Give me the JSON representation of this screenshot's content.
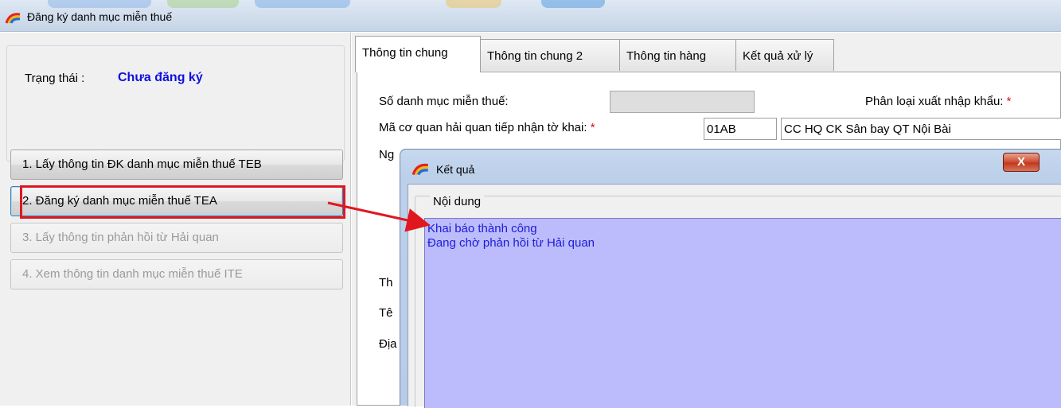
{
  "window": {
    "title": "Đăng ký danh mục miễn thuế"
  },
  "status": {
    "label": "Trạng thái :",
    "value": "Chưa đăng ký"
  },
  "actions": [
    {
      "label": "1. Lấy thông tin ĐK danh mục miễn thuế TEB",
      "state": "enabled"
    },
    {
      "label": "2. Đăng ký danh mục miễn thuế TEA",
      "state": "selected"
    },
    {
      "label": "3. Lấy thông tin phản hồi từ Hải quan",
      "state": "disabled"
    },
    {
      "label": "4. Xem thông tin danh mục miễn thuế ITE",
      "state": "disabled"
    }
  ],
  "tabs": [
    {
      "label": "Thông tin chung",
      "active": true
    },
    {
      "label": "Thông tin chung 2",
      "active": false
    },
    {
      "label": "Thông tin hàng",
      "active": false
    },
    {
      "label": "Kết quả xử lý",
      "active": false
    }
  ],
  "form": {
    "so_danh_muc_label": "Số danh mục miễn thuế:",
    "so_danh_muc_value": "",
    "phan_loai_label": "Phân loại xuất nhập khẩu:",
    "required_mark": "*",
    "ma_co_quan_label": "Mã cơ quan hải quan tiếp nhận tờ khai:",
    "ma_co_quan_code": "01AB",
    "ma_co_quan_name": "CC HQ CK Sân bay QT Nội Bài",
    "partial_label_1": "Ng",
    "partial_label_2": "Th",
    "partial_label_3": "Tê",
    "partial_label_4": "Địa"
  },
  "dialog": {
    "title": "Kết quả",
    "close_label": "X",
    "group_label": "Nội dung",
    "result_lines": [
      "Khai báo thành công",
      "Đang chờ phản hồi từ Hải quan"
    ]
  },
  "colors": {
    "status_value": "#1010e0",
    "highlight": "#e0171f",
    "result_background": "#bcbcfc",
    "result_text": "#1c1cd6",
    "required": "#e01010"
  }
}
